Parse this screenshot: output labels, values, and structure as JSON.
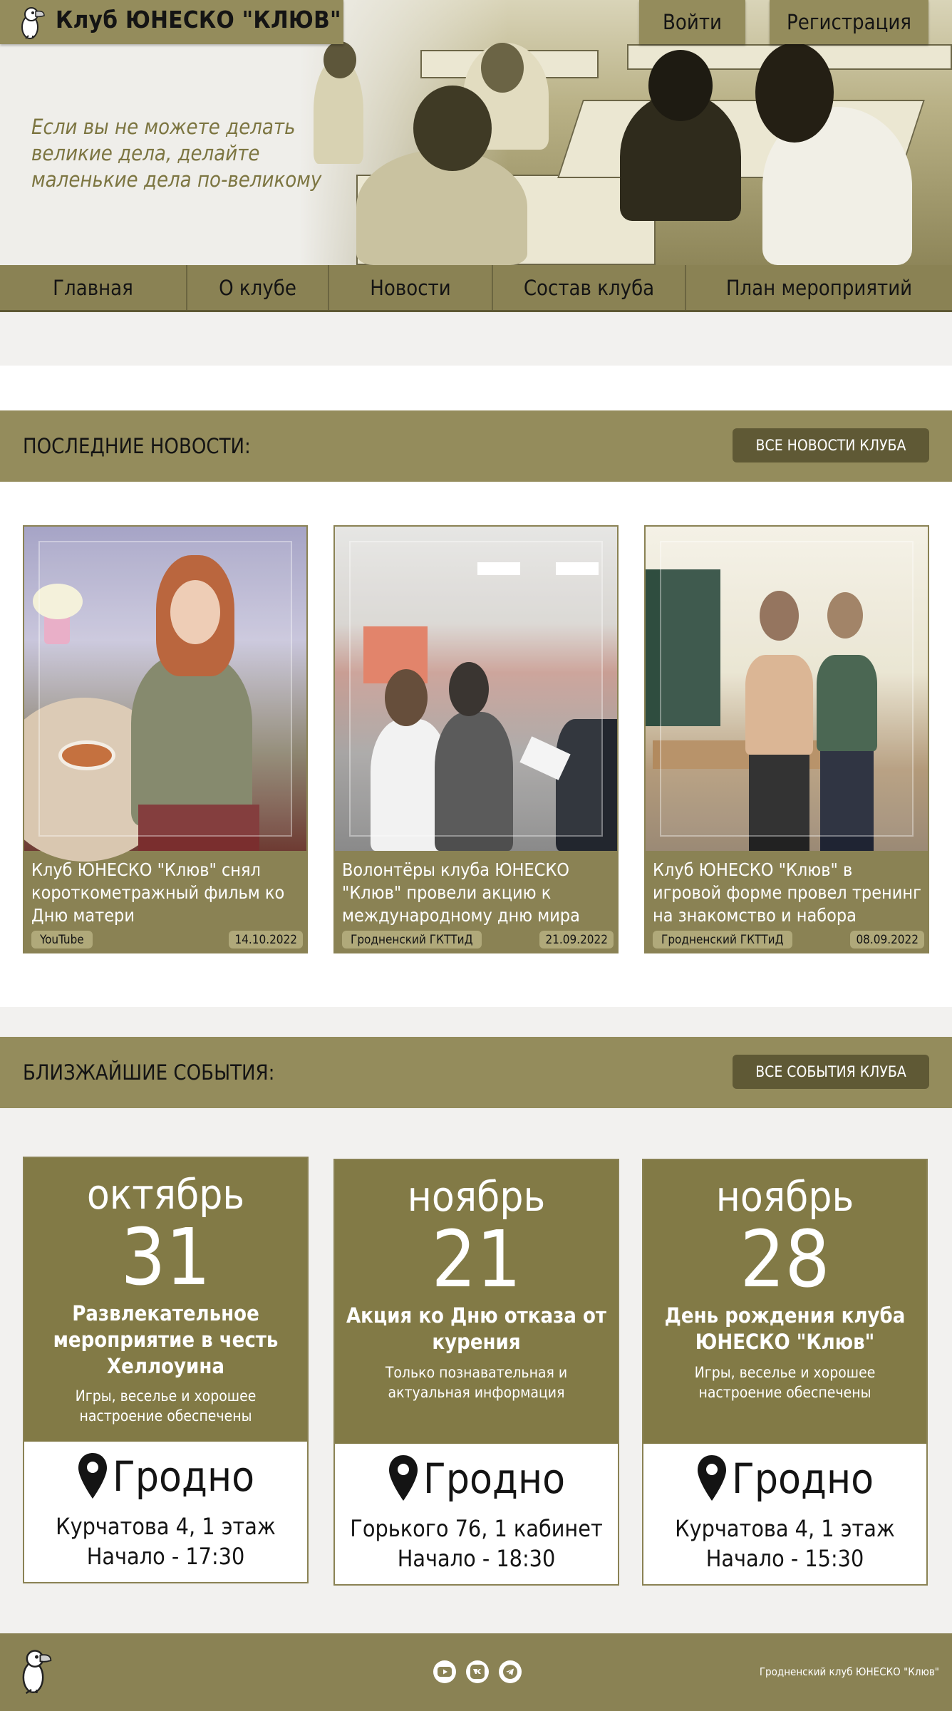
{
  "brand": {
    "title": "Клуб ЮНЕСКО \"КЛЮВ\""
  },
  "header": {
    "login": "Войти",
    "register": "Регистрация"
  },
  "hero": {
    "quote": "Если вы не можете делать великие дела, делайте маленькие дела по-великому"
  },
  "nav": {
    "items": [
      {
        "label": "Главная"
      },
      {
        "label": "О клубе"
      },
      {
        "label": "Новости"
      },
      {
        "label": "Состав клуба"
      },
      {
        "label": "План мероприятий"
      }
    ]
  },
  "news": {
    "title": "ПОСЛЕДНИЕ НОВОСТИ:",
    "all_button": "ВСЕ НОВОСТИ КЛУБА",
    "cards": [
      {
        "text": "Клуб ЮНЕСКО \"Клюв\" снял короткометражный фильм ко Дню матери",
        "source": "YouTube",
        "date": "14.10.2022"
      },
      {
        "text": "Волонтёры клуба ЮНЕСКО \"Клюв\" провели акцию к международному дню мира",
        "source": "Гродненский ГКТТиД",
        "date": "21.09.2022"
      },
      {
        "text": "Клуб ЮНЕСКО \"Клюв\" в игровой форме провел тренинг на знакомство и набора новичков",
        "source": "Гродненский ГКТТиД",
        "date": "08.09.2022"
      }
    ]
  },
  "events": {
    "title": "БЛИЗЖАЙШИЕ СОБЫТИЯ:",
    "all_button": "ВСЕ СОБЫТИЯ КЛУБА",
    "cards": [
      {
        "month": "октябрь",
        "day": "31",
        "title": "Развлекательное мероприятие в честь Хеллоуина",
        "desc": "Игры, веселье и хорошее настроение обеспечены",
        "city": "Гродно",
        "address": "Курчатова 4, 1 этаж",
        "start": "Начало - 17:30"
      },
      {
        "month": "ноябрь",
        "day": "21",
        "title": "Акция ко Дню отказа от курения",
        "desc": "Только познавательная и актуальная информация",
        "city": "Гродно",
        "address": "Горького 76, 1 кабинет",
        "start": "Начало - 18:30"
      },
      {
        "month": "ноябрь",
        "day": "28",
        "title": "День рождения клуба ЮНЕСКО \"Клюв\"",
        "desc": "Игры, веселье и хорошее настроение обеспечены",
        "city": "Гродно",
        "address": "Курчатова 4, 1 этаж",
        "start": "Начало - 15:30"
      }
    ]
  },
  "footer": {
    "copyright": "Гродненский клуб ЮНЕСКО \"Клюв\"",
    "socials": [
      "youtube-icon",
      "vk-icon",
      "telegram-icon"
    ]
  },
  "colors": {
    "olive": "#948c5c",
    "olive_dark": "#827a46",
    "button_dark": "#5f5935",
    "quote": "#7c7541"
  }
}
